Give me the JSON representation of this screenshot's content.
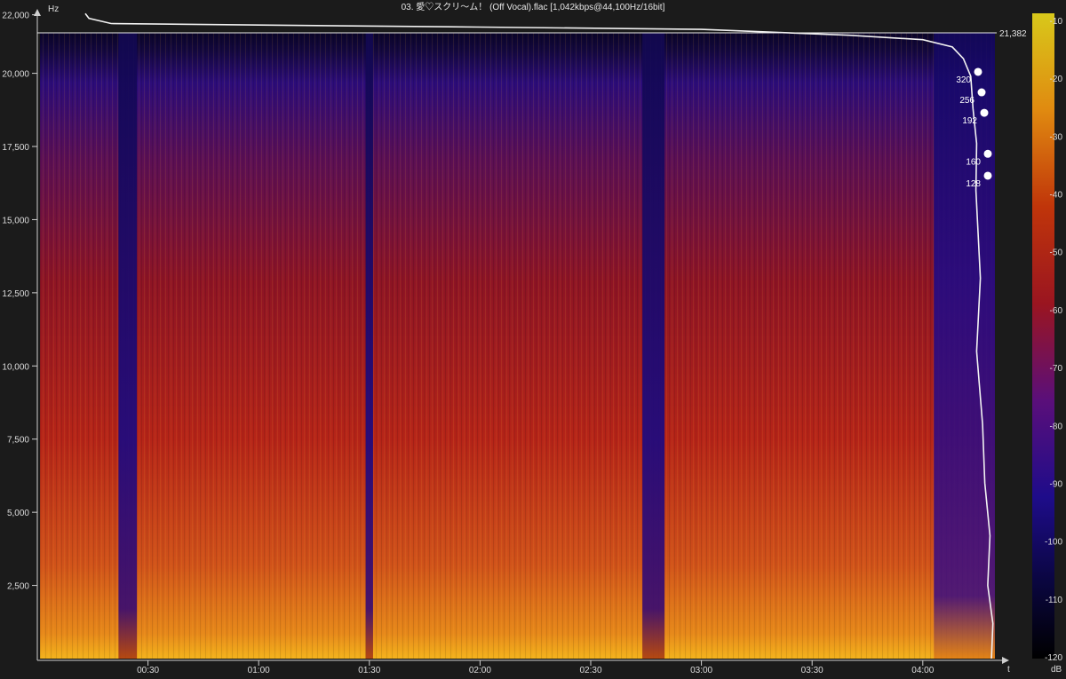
{
  "chart_data": {
    "type": "heatmap",
    "title": "03. 愛♡スクリ～ム！ (Off Vocal).flac [1,042kbps@44,100Hz/16bit]",
    "ylabel": "Hz",
    "xlabel": "t",
    "colorbar_label": "dB",
    "ylim": [
      0,
      22050
    ],
    "xlim_seconds": [
      0,
      268
    ],
    "y_ticks": [
      "2,500",
      "5,000",
      "7,500",
      "10,000",
      "12,500",
      "15,000",
      "17,500",
      "20,000",
      "22,000"
    ],
    "y_tick_values": [
      2500,
      5000,
      7500,
      10000,
      12500,
      15000,
      17500,
      20000,
      22000
    ],
    "x_ticks": [
      "00:30",
      "01:00",
      "01:30",
      "02:00",
      "02:30",
      "03:00",
      "03:30",
      "04:00"
    ],
    "x_tick_values": [
      30,
      60,
      90,
      120,
      150,
      180,
      210,
      240
    ],
    "colorbar_ticks": [
      "-10",
      "-20",
      "-30",
      "-40",
      "-50",
      "-60",
      "-70",
      "-80",
      "-90",
      "-100",
      "-110",
      "-120"
    ],
    "colorbar_values": [
      -10,
      -20,
      -30,
      -40,
      -50,
      -60,
      -70,
      -80,
      -90,
      -100,
      -110,
      -120
    ],
    "cutoff_frequency_label": "21,382",
    "cutoff_frequency": 21382,
    "bitrate_markers": [
      {
        "label": "320",
        "freq": 20050
      },
      {
        "label": "256",
        "freq": 19350
      },
      {
        "label": "192",
        "freq": 18650
      },
      {
        "label": "160",
        "freq": 17250
      },
      {
        "label": "128",
        "freq": 16500
      }
    ],
    "quiet_regions_seconds": [
      [
        22,
        27
      ],
      [
        89,
        91
      ],
      [
        164,
        170
      ]
    ],
    "colors": {
      "background": "#1b1b1b",
      "axis": "#cfcfcf",
      "loud": "#ffd23a",
      "mid": "#b01a15",
      "quiet": "#1a0a6a",
      "floor": "#000000"
    }
  }
}
